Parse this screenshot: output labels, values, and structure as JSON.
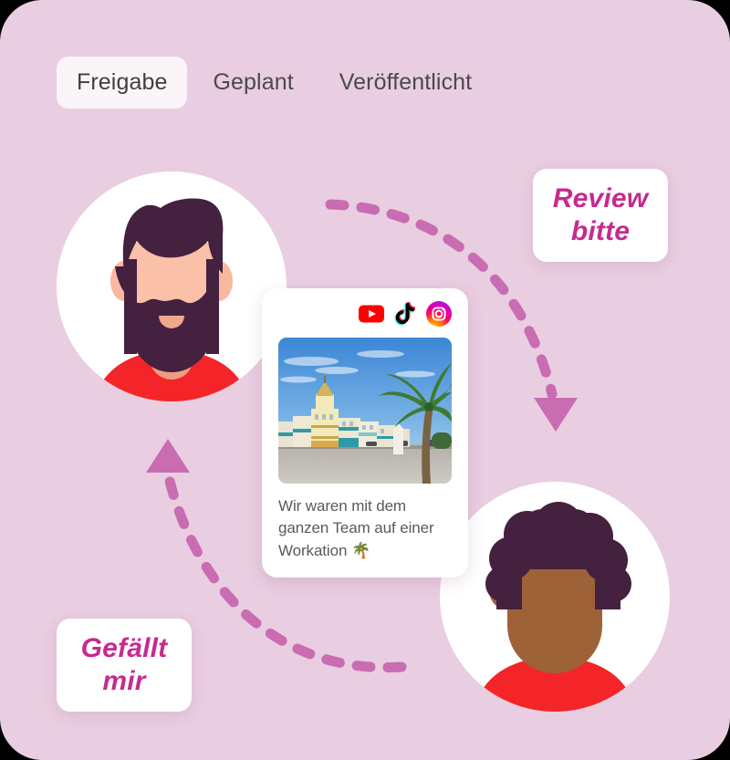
{
  "theme": {
    "background": "#e9cde0",
    "card_background": "#ffffff",
    "accent_pink": "#c96cb2",
    "bubble_text_color": "#c62a8f",
    "tab_active_background": "#fbf5f9",
    "tab_text_color": "#4a4a4a",
    "shirt_red": "#f32528",
    "hair_dark_purple": "#44213f",
    "skin_light": "#f9b99f",
    "skin_brown": "#9e6238"
  },
  "tabs": [
    {
      "label": "Freigabe",
      "active": true
    },
    {
      "label": "Geplant",
      "active": false
    },
    {
      "label": "Veröffentlicht",
      "active": false
    }
  ],
  "post_card": {
    "social_icons": [
      {
        "name": "youtube-icon",
        "label": "YouTube"
      },
      {
        "name": "tiktok-icon",
        "label": "TikTok"
      },
      {
        "name": "instagram-icon",
        "label": "Instagram"
      }
    ],
    "image_alt": "Strandpromenade mit Kolonialhäusern und Palme",
    "caption": "Wir waren mit dem ganzen Team auf einer Workation 🌴"
  },
  "bubbles": [
    {
      "name": "review-bubble",
      "text": "Review bitte"
    },
    {
      "name": "like-bubble",
      "text": "Gefällt mir"
    }
  ],
  "avatars": [
    {
      "name": "author-avatar",
      "description": "Bärtiger Mann mit rotem Shirt"
    },
    {
      "name": "reviewer-avatar",
      "description": "Person mit lockigem Haar und rotem Shirt"
    }
  ],
  "arrows": [
    {
      "name": "review-arrow",
      "direction": "down",
      "from": "author-avatar",
      "to": "reviewer-avatar"
    },
    {
      "name": "like-arrow",
      "direction": "up",
      "from": "reviewer-avatar",
      "to": "author-avatar"
    }
  ]
}
